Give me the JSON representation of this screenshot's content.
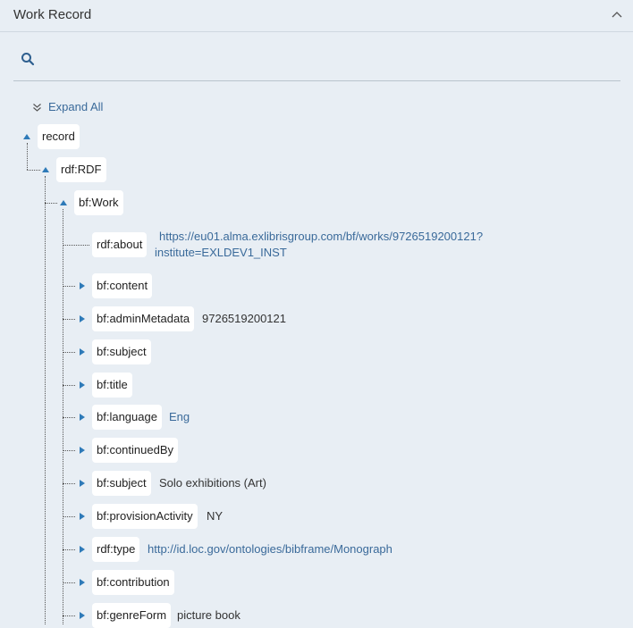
{
  "panel": {
    "title": "Work Record"
  },
  "toolbar": {
    "expand_all": "Expand All"
  },
  "icons": {
    "search": "search-icon",
    "collapse": "chevron-up-icon",
    "expand_all": "double-chevron-down-icon"
  },
  "colors": {
    "link": "#3a6a9a",
    "toggle": "#2e7ab8",
    "background": "#e8eef4"
  },
  "tree": {
    "record": "record",
    "rdf": "rdf:RDF",
    "work": "bf:Work",
    "children": [
      {
        "label": "rdf:about",
        "value": "https://eu01.alma.exlibrisgroup.com/bf/works/9726519200121?",
        "value2": "institute=EXLDEV1_INST"
      },
      {
        "label": "bf:content"
      },
      {
        "label": "bf:adminMetadata",
        "value": "9726519200121"
      },
      {
        "label": "bf:subject"
      },
      {
        "label": "bf:title"
      },
      {
        "label": "bf:language",
        "value": "Eng"
      },
      {
        "label": "bf:continuedBy"
      },
      {
        "label": "bf:subject",
        "value": "Solo exhibitions (Art)"
      },
      {
        "label": "bf:provisionActivity",
        "value": "NY"
      },
      {
        "label": "rdf:type",
        "value": "http://id.loc.gov/ontologies/bibframe/Monograph"
      },
      {
        "label": "bf:contribution"
      },
      {
        "label": "bf:genreForm",
        "value": "picture book"
      }
    ]
  }
}
